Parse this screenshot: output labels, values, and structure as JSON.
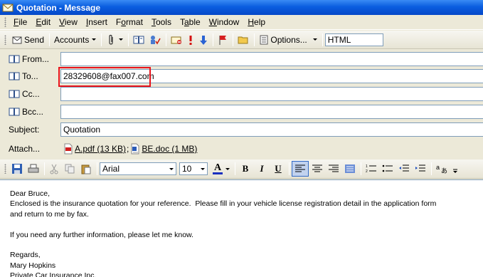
{
  "window": {
    "title": "Quotation - Message"
  },
  "menu": [
    {
      "pre": "",
      "u": "F",
      "post": "ile"
    },
    {
      "pre": "",
      "u": "E",
      "post": "dit"
    },
    {
      "pre": "",
      "u": "V",
      "post": "iew"
    },
    {
      "pre": "",
      "u": "I",
      "post": "nsert"
    },
    {
      "pre": "F",
      "u": "o",
      "post": "rmat"
    },
    {
      "pre": "",
      "u": "T",
      "post": "ools"
    },
    {
      "pre": "T",
      "u": "a",
      "post": "ble"
    },
    {
      "pre": "",
      "u": "W",
      "post": "indow"
    },
    {
      "pre": "",
      "u": "H",
      "post": "elp"
    }
  ],
  "toolbar": {
    "send_label": "Send",
    "accounts_label": "Accounts",
    "options_label": "Options...",
    "format_value": "HTML"
  },
  "fields": {
    "from_label": "From...",
    "from_value": "",
    "to_label": "To...",
    "to_value": "28329608@fax007.com",
    "cc_label": "Cc...",
    "cc_value": "",
    "bcc_label": "Bcc...",
    "bcc_value": "",
    "subject_label": "Subject:",
    "subject_value": "Quotation",
    "attach_label": "Attach...",
    "attachments": [
      {
        "name": "A.pdf (13 KB)",
        "type": "pdf-icon"
      },
      {
        "name": "BE.doc (1 MB)",
        "type": "word-doc-icon"
      }
    ],
    "attach_separator": ";"
  },
  "format_toolbar": {
    "font_value": "Arial",
    "size_value": "10",
    "bold": "B",
    "italic": "I",
    "underline": "U",
    "text_color": "A"
  },
  "body": {
    "lines": [
      "Dear Bruce,",
      "Enclosed is the insurance quotation for your reference.  Please fill in your vehicle license registration detail in the application form",
      "and return to me by fax.",
      "",
      "If you need any further information, please let me know.",
      "",
      "Regards,",
      "Mary Hopkins",
      "Private Car Insurance Inc."
    ]
  },
  "colors": {
    "title_bar": "#0a5ee0",
    "highlight": "#e8131b",
    "field_border": "#7f9db9"
  }
}
